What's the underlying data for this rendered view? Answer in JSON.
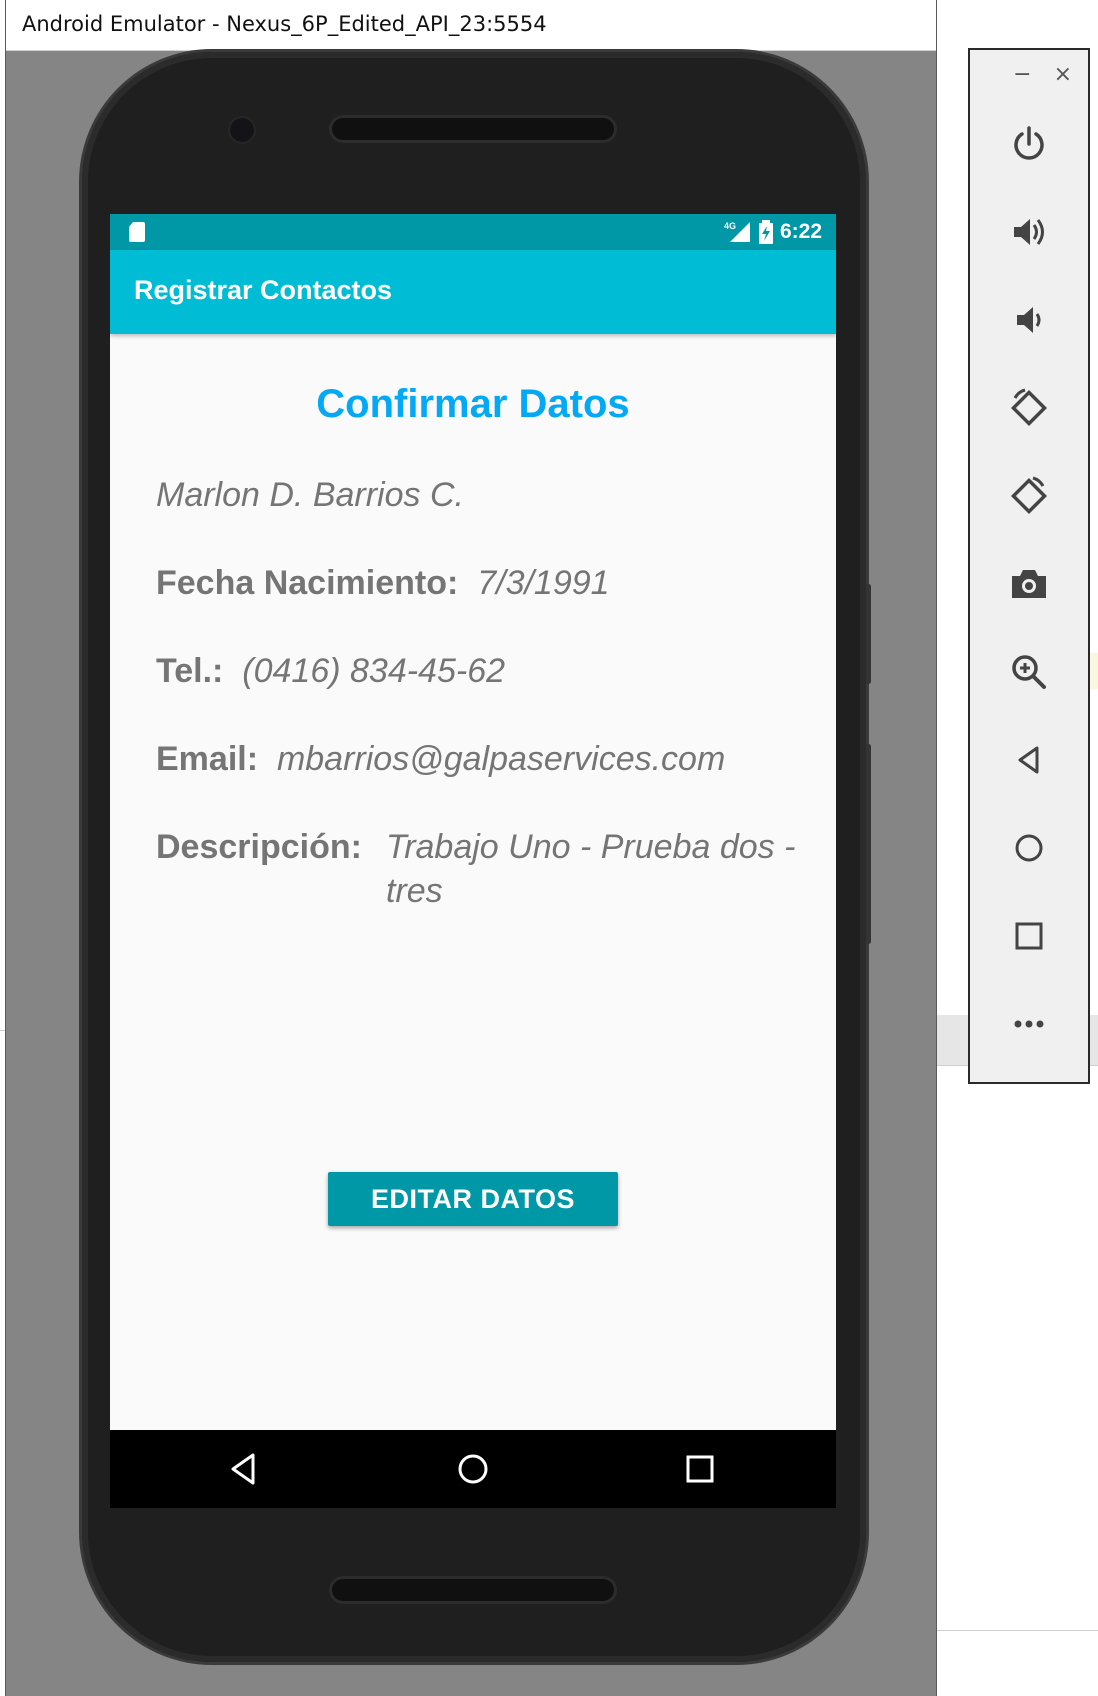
{
  "window": {
    "title": "Android Emulator - Nexus_6P_Edited_API_23:5554"
  },
  "status_bar": {
    "network_label": "4G",
    "time": "6:22"
  },
  "app_bar": {
    "title": "Registrar Contactos"
  },
  "content": {
    "heading": "Confirmar Datos",
    "name": "Marlon D. Barrios C.",
    "fields": [
      {
        "label": "Fecha Nacimiento:",
        "value": "7/3/1991"
      },
      {
        "label": "Tel.:",
        "value": "(0416) 834-45-62"
      },
      {
        "label": "Email:",
        "value": "mbarrios@galpaservices.com"
      },
      {
        "label": "Descripción:",
        "value": "Trabajo Uno - Prueba dos - tres"
      }
    ],
    "edit_button_label": "EDITAR DATOS"
  },
  "navigation_bar": {
    "buttons": [
      "back-icon",
      "home-icon",
      "recents-icon"
    ]
  },
  "emulator_toolbar": {
    "window_controls": {
      "minimize": "−",
      "close": "×"
    },
    "buttons": [
      "power-icon",
      "volume-up-icon",
      "volume-down-icon",
      "rotate-left-icon",
      "rotate-right-icon",
      "camera-icon",
      "zoom-icon",
      "back-icon",
      "home-icon",
      "overview-icon",
      "more-icon"
    ]
  },
  "colors": {
    "status_bar": "#0097a7",
    "app_bar": "#00bcd4",
    "heading": "#03a9f4",
    "button": "#0097a7",
    "text": "#757575"
  }
}
